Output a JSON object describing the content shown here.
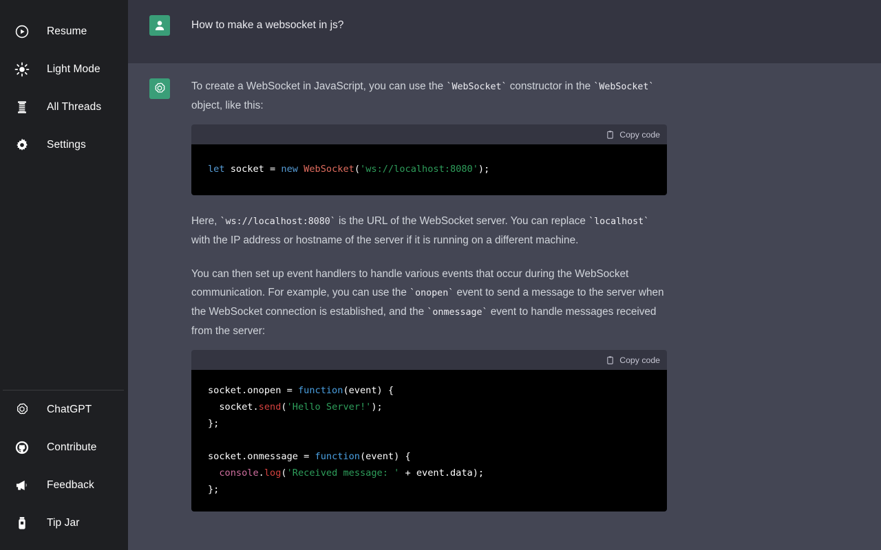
{
  "sidebar": {
    "top_items": [
      {
        "label": "Resume",
        "icon": "play-circle-icon"
      },
      {
        "label": "Light Mode",
        "icon": "sun-icon"
      },
      {
        "label": "All Threads",
        "icon": "thread-spool-icon"
      },
      {
        "label": "Settings",
        "icon": "gear-icon"
      }
    ],
    "bottom_items": [
      {
        "label": "ChatGPT",
        "icon": "openai-logo-icon"
      },
      {
        "label": "Contribute",
        "icon": "github-icon"
      },
      {
        "label": "Feedback",
        "icon": "megaphone-icon"
      },
      {
        "label": "Tip Jar",
        "icon": "tip-jar-icon"
      }
    ]
  },
  "conversation": {
    "user_message": {
      "avatar_icon": "user-avatar-icon",
      "text": "How to make a websocket in js?"
    },
    "assistant_message": {
      "avatar_icon": "openai-avatar-icon",
      "paragraph_1": {
        "p1": "To create a WebSocket in JavaScript, you can use the ",
        "c1": "`WebSocket`",
        "p2": " constructor in the ",
        "c2": "`WebSocket`",
        "p3": " object, like this:"
      },
      "code_block_1": {
        "copy_label": "Copy code",
        "copy_icon": "clipboard-icon",
        "tokens": [
          {
            "t": "let",
            "c": "kw"
          },
          {
            "t": " socket ",
            "c": "pun"
          },
          {
            "t": "= ",
            "c": "pun"
          },
          {
            "t": "new ",
            "c": "kw"
          },
          {
            "t": "WebSocket",
            "c": "cls"
          },
          {
            "t": "(",
            "c": "pun"
          },
          {
            "t": "'ws://localhost:8080'",
            "c": "str"
          },
          {
            "t": ");",
            "c": "pun"
          }
        ],
        "plain_text": "let socket = new WebSocket('ws://localhost:8080');"
      },
      "paragraph_2": {
        "p1": "Here, ",
        "c1": "`ws://localhost:8080`",
        "p2": " is the URL of the WebSocket server. You can replace ",
        "c2": "`localhost`",
        "p3": " with the IP address or hostname of the server if it is running on a different machine."
      },
      "paragraph_3": {
        "p1": "You can then set up event handlers to handle various events that occur during the WebSocket communication. For example, you can use the ",
        "c1": "`onopen`",
        "p2": " event to send a message to the server when the WebSocket connection is established, and the ",
        "c2": "`onmessage`",
        "p3": " event to handle messages received from the server:"
      },
      "code_block_2": {
        "copy_label": "Copy code",
        "copy_icon": "clipboard-icon",
        "lines": [
          [
            {
              "t": "socket.onopen ",
              "c": "pun"
            },
            {
              "t": "= ",
              "c": "pun"
            },
            {
              "t": "function",
              "c": "fn"
            },
            {
              "t": "(event) {",
              "c": "pun"
            }
          ],
          [
            {
              "t": "  socket.",
              "c": "pun"
            },
            {
              "t": "send",
              "c": "meth"
            },
            {
              "t": "(",
              "c": "pun"
            },
            {
              "t": "'Hello Server!'",
              "c": "str"
            },
            {
              "t": ");",
              "c": "pun"
            }
          ],
          [
            {
              "t": "};",
              "c": "pun"
            }
          ],
          [
            {
              "t": "",
              "c": "pun"
            }
          ],
          [
            {
              "t": "socket.onmessage ",
              "c": "pun"
            },
            {
              "t": "= ",
              "c": "pun"
            },
            {
              "t": "function",
              "c": "fn"
            },
            {
              "t": "(event) {",
              "c": "pun"
            }
          ],
          [
            {
              "t": "  ",
              "c": "pun"
            },
            {
              "t": "console",
              "c": "obj"
            },
            {
              "t": ".",
              "c": "pun"
            },
            {
              "t": "log",
              "c": "meth"
            },
            {
              "t": "(",
              "c": "pun"
            },
            {
              "t": "'Received message: '",
              "c": "str"
            },
            {
              "t": " + event.data);",
              "c": "pun"
            }
          ],
          [
            {
              "t": "};",
              "c": "pun"
            }
          ]
        ],
        "plain_text": "socket.onopen = function(event) {\n  socket.send('Hello Server!');\n};\n\nsocket.onmessage = function(event) {\n  console.log('Received message: ' + event.data);\n};"
      }
    }
  },
  "colors": {
    "sidebar_bg": "#1e1f22",
    "user_row_bg": "#343541",
    "assistant_row_bg": "#444654",
    "code_bg": "#000000",
    "avatar_green": "#3a9e78",
    "text_primary": "#ececf1",
    "text_body": "#d1d5db"
  }
}
